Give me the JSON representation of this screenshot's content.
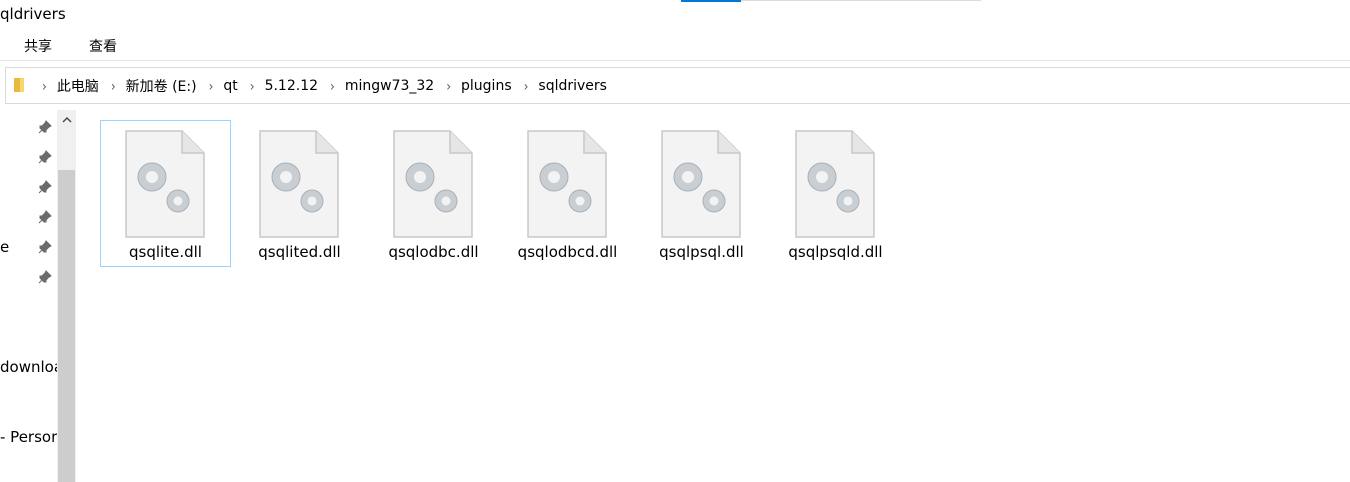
{
  "window": {
    "title": "qldrivers"
  },
  "ribbon": {
    "tabs": [
      {
        "label": "共享"
      },
      {
        "label": "查看"
      }
    ]
  },
  "address": {
    "crumbs": [
      {
        "label": "此电脑"
      },
      {
        "label": "新加卷 (E:)"
      },
      {
        "label": "qt"
      },
      {
        "label": "5.12.12"
      },
      {
        "label": "mingw73_32"
      },
      {
        "label": "plugins"
      },
      {
        "label": "sqldrivers"
      }
    ]
  },
  "nav": {
    "items": [
      {
        "label": "e"
      },
      {
        "label": "downloa"
      },
      {
        "label": "- Persor"
      }
    ],
    "pins": 6
  },
  "files": [
    {
      "name": "qsqlite.dll",
      "selected": true
    },
    {
      "name": "qsqlited.dll"
    },
    {
      "name": "qsqlodbc.dll"
    },
    {
      "name": "qsqlodbcd.dll"
    },
    {
      "name": "qsqlpsql.dll"
    },
    {
      "name": "qsqlpsqld.dll"
    }
  ],
  "icons": {
    "folder": "folder-icon",
    "pin": "pin-icon",
    "separator": "chevron-right-icon",
    "scroll_up": "chevron-up-icon",
    "file": "dll-gear-file-icon"
  },
  "colors": {
    "accent": "#0078d7",
    "selection_border": "#99d1ff"
  }
}
